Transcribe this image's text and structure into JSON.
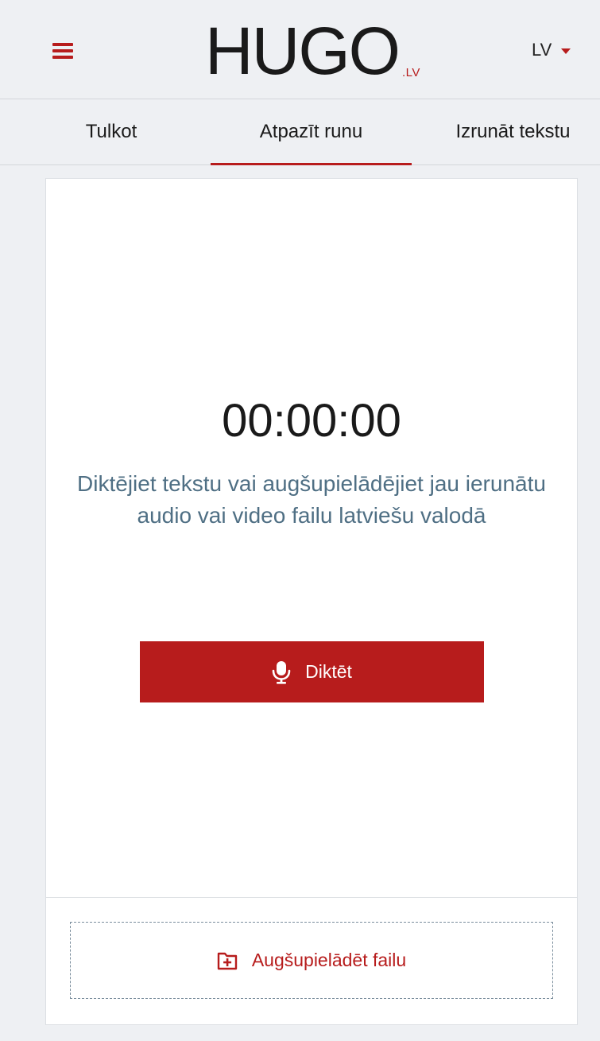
{
  "header": {
    "logo_text": "HUGO",
    "logo_suffix": ".LV",
    "language": "LV",
    "menu_icon": "hamburger-menu-icon",
    "dropdown_icon": "caret-down-icon"
  },
  "tabs": [
    {
      "label": "Tulkot",
      "active": false
    },
    {
      "label": "Atpazīt runu",
      "active": true
    },
    {
      "label": "Izrunāt tekstu",
      "active": false
    }
  ],
  "main": {
    "timer": "00:00:00",
    "hint": "Diktējiet tekstu vai augšupielādējiet jau ierunātu audio vai video failu latviešu valodā",
    "dictate_label": "Diktēt",
    "dictate_icon": "microphone-icon",
    "upload_label": "Augšupielādēt failu",
    "upload_icon": "folder-plus-icon"
  },
  "colors": {
    "accent": "#b71c1c",
    "hint_text": "#4f6f84",
    "background": "#eef0f3"
  }
}
